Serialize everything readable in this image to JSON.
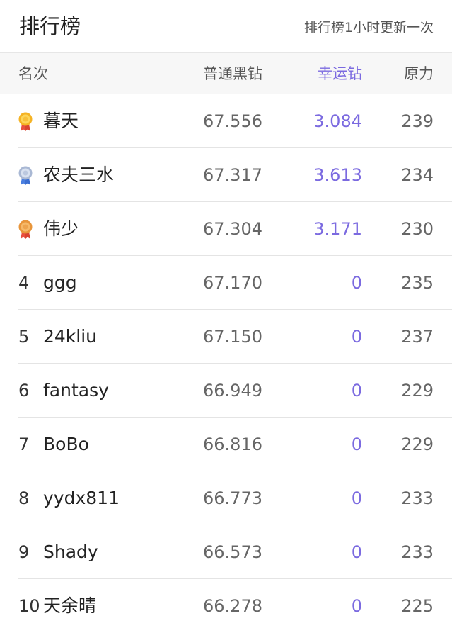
{
  "header": {
    "title": "排行榜",
    "subtitle": "排行榜1小时更新一次"
  },
  "columns": {
    "rank": "名次",
    "normal": "普通黑钻",
    "lucky": "幸运钻",
    "power": "原力"
  },
  "colors": {
    "accent_purple": "#7b6ae0",
    "gold": "#f5b324",
    "silver": "#a9b8d4",
    "bronze": "#e8953a"
  },
  "rows": [
    {
      "rank": "",
      "medal": "gold-medal-icon",
      "name": "暮天",
      "normal": "67.556",
      "lucky": "3.084",
      "power": "239"
    },
    {
      "rank": "",
      "medal": "silver-medal-icon",
      "name": "农夫三水",
      "normal": "67.317",
      "lucky": "3.613",
      "power": "234"
    },
    {
      "rank": "",
      "medal": "bronze-medal-icon",
      "name": "伟少",
      "normal": "67.304",
      "lucky": "3.171",
      "power": "230"
    },
    {
      "rank": "4",
      "name": "ggg",
      "normal": "67.170",
      "lucky": "0",
      "power": "235"
    },
    {
      "rank": "5",
      "name": "24kliu",
      "normal": "67.150",
      "lucky": "0",
      "power": "237"
    },
    {
      "rank": "6",
      "name": "fantasy",
      "normal": "66.949",
      "lucky": "0",
      "power": "229"
    },
    {
      "rank": "7",
      "name": "BoBo",
      "normal": "66.816",
      "lucky": "0",
      "power": "229"
    },
    {
      "rank": "8",
      "name": "yydx811",
      "normal": "66.773",
      "lucky": "0",
      "power": "233"
    },
    {
      "rank": "9",
      "name": "Shady",
      "normal": "66.573",
      "lucky": "0",
      "power": "233"
    },
    {
      "rank": "10",
      "name": "天余晴",
      "normal": "66.278",
      "lucky": "0",
      "power": "225"
    }
  ]
}
